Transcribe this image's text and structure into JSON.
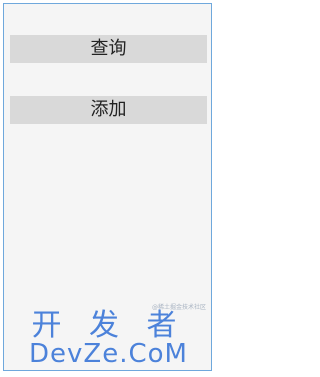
{
  "buttons": {
    "query_label": "查询",
    "add_label": "添加"
  },
  "watermark": {
    "small_text": "@稀土掘金技术社区",
    "title": "开 发 者",
    "subtitle": "DevZe.CoM",
    "color": "#2f6fd6"
  },
  "colors": {
    "background": "#f5f5f5",
    "border": "#6fa8dc",
    "button_bg": "#d9d9d9"
  }
}
